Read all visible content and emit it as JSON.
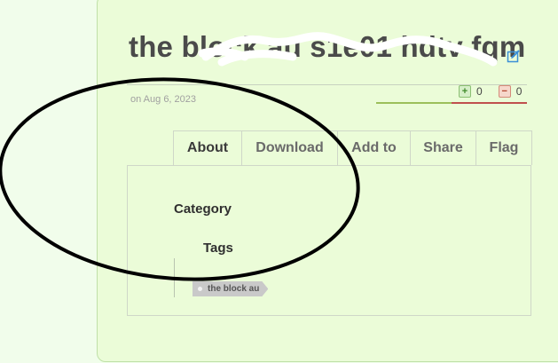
{
  "page": {
    "title": "the block au s1e01 hdtv fqm",
    "date": "on Aug 6, 2023"
  },
  "votes": {
    "up_symbol": "+",
    "up_count": "0",
    "down_symbol": "−",
    "down_count": "0",
    "up_color": "#9cbf5b",
    "down_color": "#c0504d"
  },
  "tabs": [
    {
      "label": "About",
      "active": true
    },
    {
      "label": "Download",
      "active": false
    },
    {
      "label": "Add to",
      "active": false
    },
    {
      "label": "Share",
      "active": false
    },
    {
      "label": "Flag",
      "active": false
    }
  ],
  "about": {
    "category_label": "Category",
    "tags_label": "Tags",
    "tags": [
      "the block au"
    ]
  },
  "icons": {
    "edit": "edit-icon"
  }
}
